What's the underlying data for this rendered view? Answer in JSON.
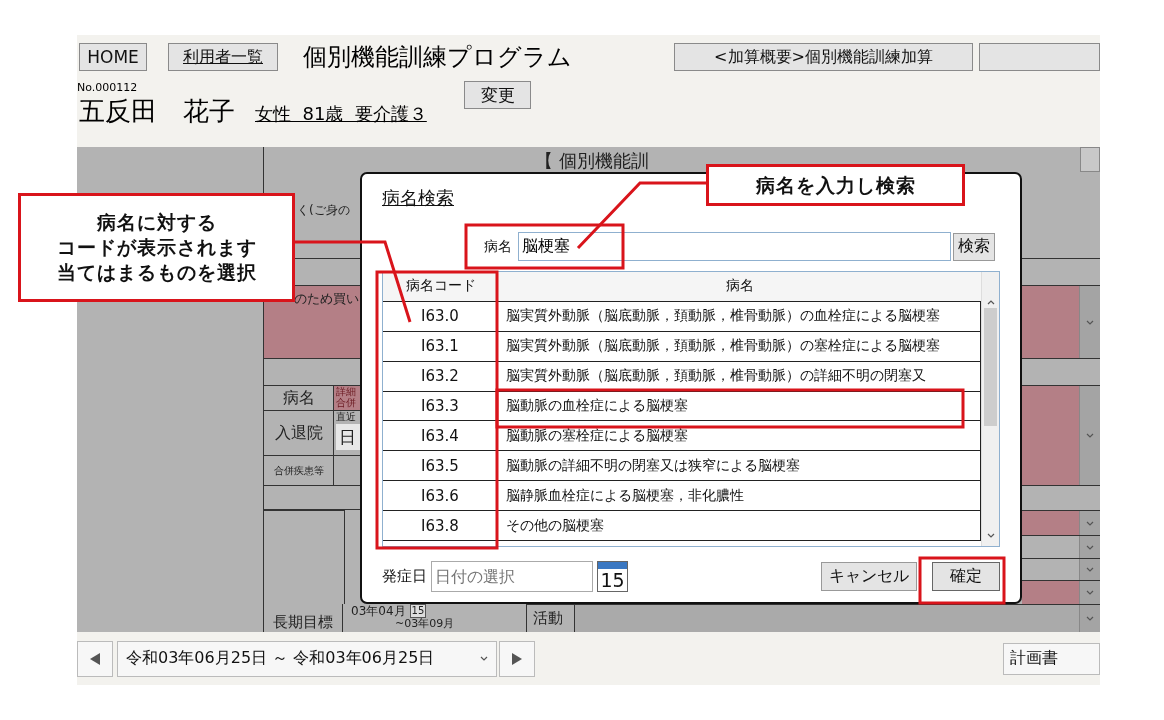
{
  "header": {
    "home_button": "HOME",
    "user_list_link": "利用者一覧",
    "program_title": "個別機能訓練プログラム",
    "summary_button": "<加算概要>個別機能訓練加算",
    "user_no": "No.000112",
    "user_name": "五反田　花子",
    "user_info": "女性  81歳  要介護３",
    "change_button": "変更"
  },
  "form_background": {
    "heading": "【 個別機能訓",
    "fragment_1": "く(ご身の",
    "fragment_2": "のため買い",
    "disease_label": "病名",
    "detail_notes": [
      "詳細",
      "合併"
    ],
    "admission_label": "入退院",
    "recent_note": "直近",
    "date_fragment": "日",
    "complication_label": "合併疾患等",
    "long_term_label": "長期目標",
    "start_date": "03年04月",
    "calendar_day": "15",
    "end_date": "~03年09月",
    "activity_label": "活動"
  },
  "dialog": {
    "title": "病名検索",
    "search_label": "病名",
    "search_value": "脳梗塞",
    "search_button": "検索",
    "columns": [
      "病名コード",
      "病名"
    ],
    "rows": [
      {
        "code": "I63.0",
        "name": "脳実質外動脈（脳底動脈，頚動脈，椎骨動脈）の血栓症による脳梗塞",
        "selected": false
      },
      {
        "code": "I63.1",
        "name": "脳実質外動脈（脳底動脈，頚動脈，椎骨動脈）の塞栓症による脳梗塞",
        "selected": false
      },
      {
        "code": "I63.2",
        "name": "脳実質外動脈（脳底動脈，頚動脈，椎骨動脈）の詳細不明の閉塞又",
        "selected": false
      },
      {
        "code": "I63.3",
        "name": "脳動脈の血栓症による脳梗塞",
        "selected": false
      },
      {
        "code": "I63.4",
        "name": "脳動脈の塞栓症による脳梗塞",
        "selected": false
      },
      {
        "code": "I63.5",
        "name": "脳動脈の詳細不明の閉塞又は狭窄による脳梗塞",
        "selected": false
      },
      {
        "code": "I63.6",
        "name": "脳静脈血栓症による脳梗塞，非化膿性",
        "selected": false
      },
      {
        "code": "I63.8",
        "name": "その他の脳梗塞",
        "selected": false
      }
    ],
    "onset_label": "発症日",
    "onset_placeholder": "日付の選択",
    "calendar_day": "15",
    "cancel_button": "キャンセル",
    "confirm_button": "確定"
  },
  "footer": {
    "date_range": "令和03年06月25日 ～ 令和03年06月25日",
    "plan_button": "計画書"
  },
  "annotations": [
    {
      "lines": [
        "病名に対する",
        "コードが表示されます",
        "当てはまるものを選択"
      ]
    },
    {
      "lines": [
        "病名を入力し検索"
      ]
    }
  ]
}
